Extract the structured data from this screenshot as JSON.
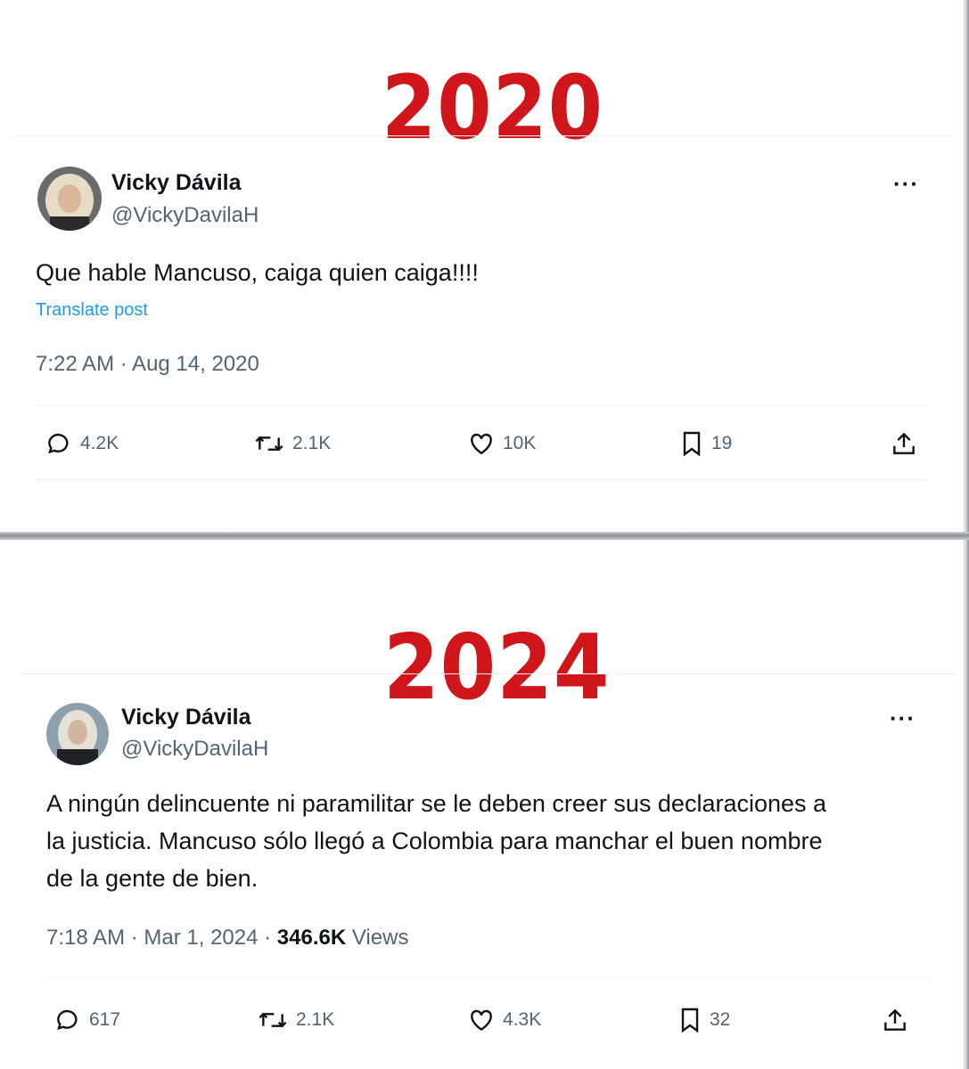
{
  "top": {
    "year": "2020",
    "tweet": {
      "author_name": "Vicky Dávila",
      "author_handle": "@VickyDavilaH",
      "more_label": "···",
      "text": "Que hable Mancuso, caiga quien caiga!!!!",
      "translate_label": "Translate post",
      "timestamp": "7:22 AM · Aug 14, 2020",
      "actions": {
        "replies": "4.2K",
        "reposts": "2.1K",
        "likes": "10K",
        "bookmarks": "19"
      }
    }
  },
  "bottom": {
    "year": "2024",
    "tweet": {
      "author_name": "Vicky Dávila",
      "author_handle": "@VickyDavilaH",
      "more_label": "···",
      "text_lines": [
        "A ningún delincuente ni paramilitar se le deben creer sus declaraciones a",
        "la justicia. Mancuso sólo llegó a Colombia para manchar el buen nombre",
        "de la gente de bien."
      ],
      "timestamp": "7:18 AM · Mar 1, 2024 · ",
      "views_count": "346.6K",
      "views_label": " Views",
      "actions": {
        "replies": "617",
        "reposts": "2.1K",
        "likes": "4.3K",
        "bookmarks": "32"
      }
    }
  },
  "colors": {
    "year_red": "#d0161b",
    "link_blue": "#1d9bf0",
    "muted_gray": "#536471"
  },
  "icons": [
    "reply-icon",
    "repost-icon",
    "like-icon",
    "bookmark-icon",
    "share-icon"
  ]
}
